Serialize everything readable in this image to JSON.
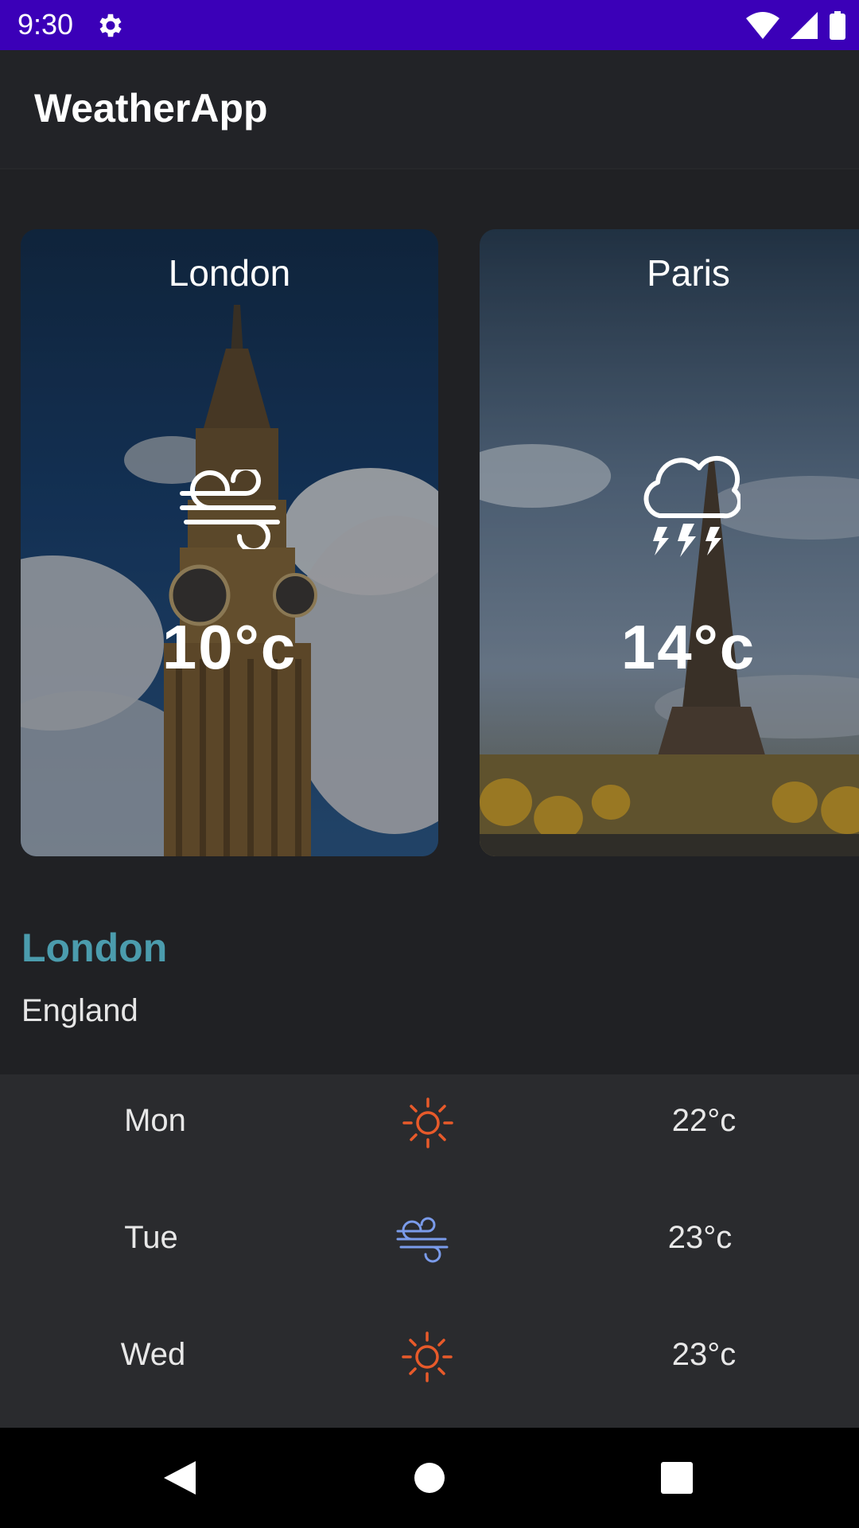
{
  "status_bar": {
    "time": "9:30"
  },
  "app_bar": {
    "title": "WeatherApp"
  },
  "cards": [
    {
      "city": "London",
      "temp": "10°c",
      "icon": "wind-icon"
    },
    {
      "city": "Paris",
      "temp": "14°c",
      "icon": "thunderstorm-icon"
    }
  ],
  "location": {
    "city": "London",
    "country": "England"
  },
  "forecast": [
    {
      "day": "Mon",
      "icon": "sun-icon",
      "temp": "22°c"
    },
    {
      "day": "Tue",
      "icon": "wind-icon",
      "temp": "23°c"
    },
    {
      "day": "Wed",
      "icon": "sun-icon",
      "temp": "23°c"
    }
  ],
  "colors": {
    "status_bar": "#3b00b8",
    "accent": "#4b9cad",
    "sun_icon": "#e85a2a",
    "wind_icon": "#7a9bea",
    "background": "#202124"
  }
}
